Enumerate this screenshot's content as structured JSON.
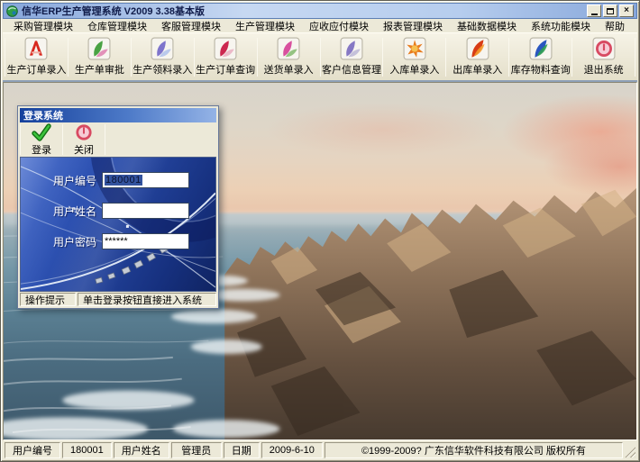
{
  "window": {
    "title": "信华ERP生产管理系统 V2009 3.38基本版",
    "controls": {
      "close": "×"
    }
  },
  "menu": {
    "items": [
      "采购管理模块",
      "仓库管理模块",
      "客服管理模块",
      "生产管理模块",
      "应收应付模块",
      "报表管理模块",
      "基础数据模块",
      "系统功能模块",
      "帮助"
    ]
  },
  "toolbar": {
    "buttons": [
      {
        "label": "生产订单录入",
        "icon": "ribbon-a-icon",
        "c1": "#d8281e",
        "c2": "#f0b4aa"
      },
      {
        "label": "生产单审批",
        "icon": "flower-icon",
        "c1": "#4aa244",
        "c2": "#e088b4"
      },
      {
        "label": "生产领料录入",
        "icon": "flower-icon",
        "c1": "#7e74cc",
        "c2": "#b4c4ec"
      },
      {
        "label": "生产订单查询",
        "icon": "lily-icon",
        "c1": "#cc2850",
        "c2": "#eab4c4"
      },
      {
        "label": "送货单录入",
        "icon": "flower-icon",
        "c1": "#d8509e",
        "c2": "#8cbe78"
      },
      {
        "label": "客户信息管理",
        "icon": "flower-icon",
        "c1": "#8678c4",
        "c2": "#c0bcd8"
      },
      {
        "label": "入库单录入",
        "icon": "burst-icon",
        "c1": "#e87c1e",
        "c2": "#f6c050"
      },
      {
        "label": "出库单录入",
        "icon": "feather-icon",
        "c1": "#d83c16",
        "c2": "#f49a2a"
      },
      {
        "label": "库存物料查询",
        "icon": "feather-icon",
        "c1": "#2a56c0",
        "c2": "#2f9e52"
      },
      {
        "label": "退出系统",
        "icon": "power-icon",
        "c1": "#d84a62",
        "c2": "#f6ccd6"
      }
    ]
  },
  "login_dialog": {
    "title": "登录系统",
    "buttons": {
      "login": "登录",
      "close": "关闭"
    },
    "fields": {
      "user_id_label": "用户编号",
      "user_id_value": "180001",
      "user_name_label": "用户姓名",
      "user_name_value": "",
      "password_label": "用户密码",
      "password_value": "******"
    },
    "status": {
      "label": "操作提示",
      "text": "单击登录按钮直接进入系统"
    }
  },
  "statusbar": {
    "user_id_label": "用户编号",
    "user_id_value": "180001",
    "user_name_label": "用户姓名",
    "user_name_value": "管理员",
    "date_label": "日期",
    "date_value": "2009-6-10",
    "copyright": "©1999-2009?  广东信华软件科技有限公司  版权所有"
  },
  "colors": {
    "titlebar_blue": "#9ab6e4",
    "panel_beige": "#ece9d8",
    "dialog_body_blue": "#2c50b0",
    "selection_blue": "#33539e",
    "login_green": "#2fb32f",
    "power_red": "#d84a62"
  }
}
